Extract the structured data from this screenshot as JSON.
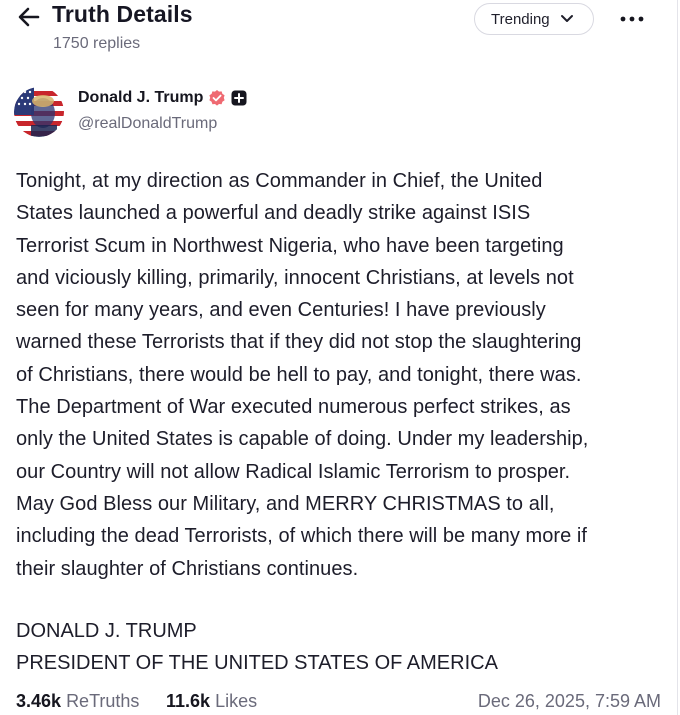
{
  "header": {
    "title": "Truth Details",
    "replies": "1750 replies",
    "sort_label": "Trending"
  },
  "author": {
    "name": "Donald J. Trump",
    "handle": "@realDonaldTrump"
  },
  "post": {
    "lines": [
      "Tonight, at my direction as Commander in Chief, the United",
      "States launched a powerful and deadly strike against ISIS",
      "Terrorist Scum in Northwest Nigeria, who have been targeting",
      "and viciously killing, primarily, innocent Christians, at levels not",
      "seen for many years, and even Centuries! I have previously",
      "warned these Terrorists that if they did not stop the slaughtering",
      "of Christians, there would be hell to pay, and tonight, there was.",
      "The Department of War executed numerous perfect strikes, as",
      "only the United States is capable of doing. Under my leadership,",
      "our Country will not allow Radical Islamic Terrorism to prosper.",
      "May God Bless our Military, and MERRY CHRISTMAS to all,",
      "including the dead Terrorists, of which there will be many more if",
      "their slaughter of Christians continues."
    ],
    "signature_name": "DONALD J. TRUMP",
    "signature_title": "PRESIDENT OF THE UNITED STATES OF AMERICA"
  },
  "stats": {
    "retruths_count": "3.46k",
    "retruths_label": "ReTruths",
    "likes_count": "11.6k",
    "likes_label": "Likes",
    "timestamp": "Dec 26, 2025, 7:59 AM"
  },
  "colors": {
    "verified_badge": "#ef6a72",
    "text_primary": "#16161f",
    "text_secondary": "#6a6a7a",
    "border": "#d9d9e1"
  },
  "icons": {
    "back": "arrow-left-icon",
    "sort": "chevron-down-icon",
    "more": "more-horizontal-icon",
    "verified": "verified-badge-icon",
    "plus": "plus-square-icon"
  }
}
